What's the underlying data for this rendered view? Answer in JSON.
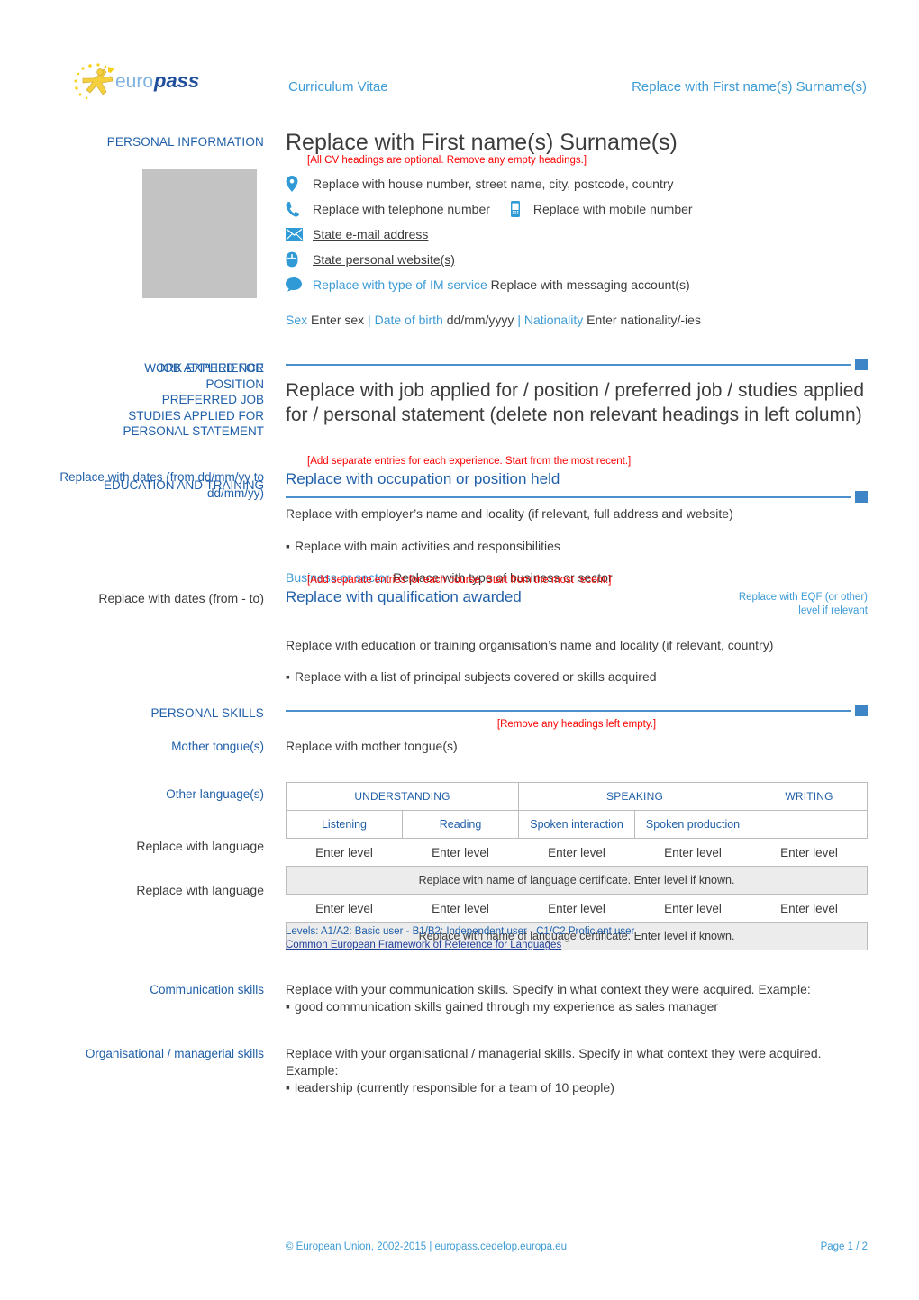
{
  "header": {
    "center_title": "Curriculum Vitae",
    "right_title": "Replace with First name(s) Surname(s)",
    "logo_text_1": "euro",
    "logo_text_2": "pass"
  },
  "personal_information": {
    "section_label": "PERSONAL INFORMATION",
    "name": "Replace with First name(s) Surname(s)",
    "note": "[All CV headings are optional. Remove any empty headings.]",
    "address": "Replace with house number, street name, city, postcode, country",
    "telephone": "Replace with telephone number",
    "mobile": "Replace with mobile number",
    "email": "State e-mail address",
    "website": "State personal website(s)",
    "im_service": "Replace with type of IM service",
    "im_account": "Replace with messaging account(s)",
    "sex_label": "Sex",
    "sex_value": "Enter sex",
    "dob_label": "Date of birth",
    "dob_value": "dd/mm/yyyy",
    "nationality_label": "Nationality",
    "nationality_value": "Enter nationality/-ies"
  },
  "job_applied": {
    "labels": [
      "WORK EXPERIENCE",
      "JOB APPLIED FOR",
      "POSITION",
      "PREFERRED JOB",
      "STUDIES APPLIED FOR",
      "PERSONAL STATEMENT"
    ],
    "title": "Replace with job applied for / position / preferred job / studies applied for / personal statement (delete non relevant headings in left column)"
  },
  "work_experience": {
    "note": "[Add separate entries for each experience. Start from the most recent.]",
    "left_label_overlap": "EDUCATION AND TRAINING",
    "dates": "Replace with dates (from dd/mm/yy to dd/mm/yy)",
    "position": "Replace with occupation or position held",
    "employer": "Replace with employer’s name and locality (if relevant, full address and website)",
    "activities": "Replace with main activities and responsibilities",
    "sector_label": "Business or sector",
    "sector_value": "Replace with type of business or sector"
  },
  "education": {
    "note": "[Add separate entries for each course. Start from the most recent.]",
    "dates": "Replace with dates (from - to)",
    "qualification": "Replace with qualification awarded",
    "eqf": "Replace with EQF (or other) level if relevant",
    "organisation": "Replace with education or training organisation’s name and locality (if relevant, country)",
    "subjects": "Replace with a list of principal subjects covered or skills acquired"
  },
  "personal_skills": {
    "section_label": "PERSONAL SKILLS",
    "note": "[Remove any headings left empty.]",
    "mother_tongue_label": "Mother tongue(s)",
    "mother_tongue_value": "Replace with mother tongue(s)",
    "other_languages_label": "Other language(s)",
    "table": {
      "group_headers": [
        "UNDERSTANDING",
        "SPEAKING",
        "WRITING"
      ],
      "sub_headers": [
        "Listening",
        "Reading",
        "Spoken interaction",
        "Spoken production",
        ""
      ],
      "rows": [
        {
          "language": "Replace with language",
          "levels": [
            "Enter level",
            "Enter level",
            "Enter level",
            "Enter level",
            "Enter level"
          ],
          "certificate": "Replace with name of language certificate. Enter level if known."
        },
        {
          "language": "Replace with language",
          "levels": [
            "Enter level",
            "Enter level",
            "Enter level",
            "Enter level",
            "Enter level"
          ],
          "certificate": "Replace with name of language certificate. Enter level if known."
        }
      ]
    },
    "levels_note": "Levels: A1/A2: Basic user - B1/B2: Independent user - C1/C2 Proficient user",
    "cefr_link": "Common European Framework of Reference for Languages",
    "communication_label": "Communication skills",
    "communication_text": "Replace with your communication skills. Specify in what context they were acquired. Example:",
    "communication_bullet": "good communication skills gained through my experience as sales manager",
    "organisational_label": "Organisational / managerial skills",
    "organisational_text": "Replace with your organisational / managerial skills. Specify in what context they were acquired. Example:",
    "organisational_bullet": "leadership (currently responsible for a team of 10 people)"
  },
  "footer": {
    "copyright": "© European Union, 2002-2015 | europass.cedefop.europa.eu",
    "page": "Page 1 / 2"
  },
  "colors": {
    "brand_blue": "#3d9bd6",
    "label_blue": "#1f5fa9",
    "divider_blue": "#4a90cd",
    "note_red": "#ff0000",
    "photo_gray": "#c3c3c3"
  }
}
